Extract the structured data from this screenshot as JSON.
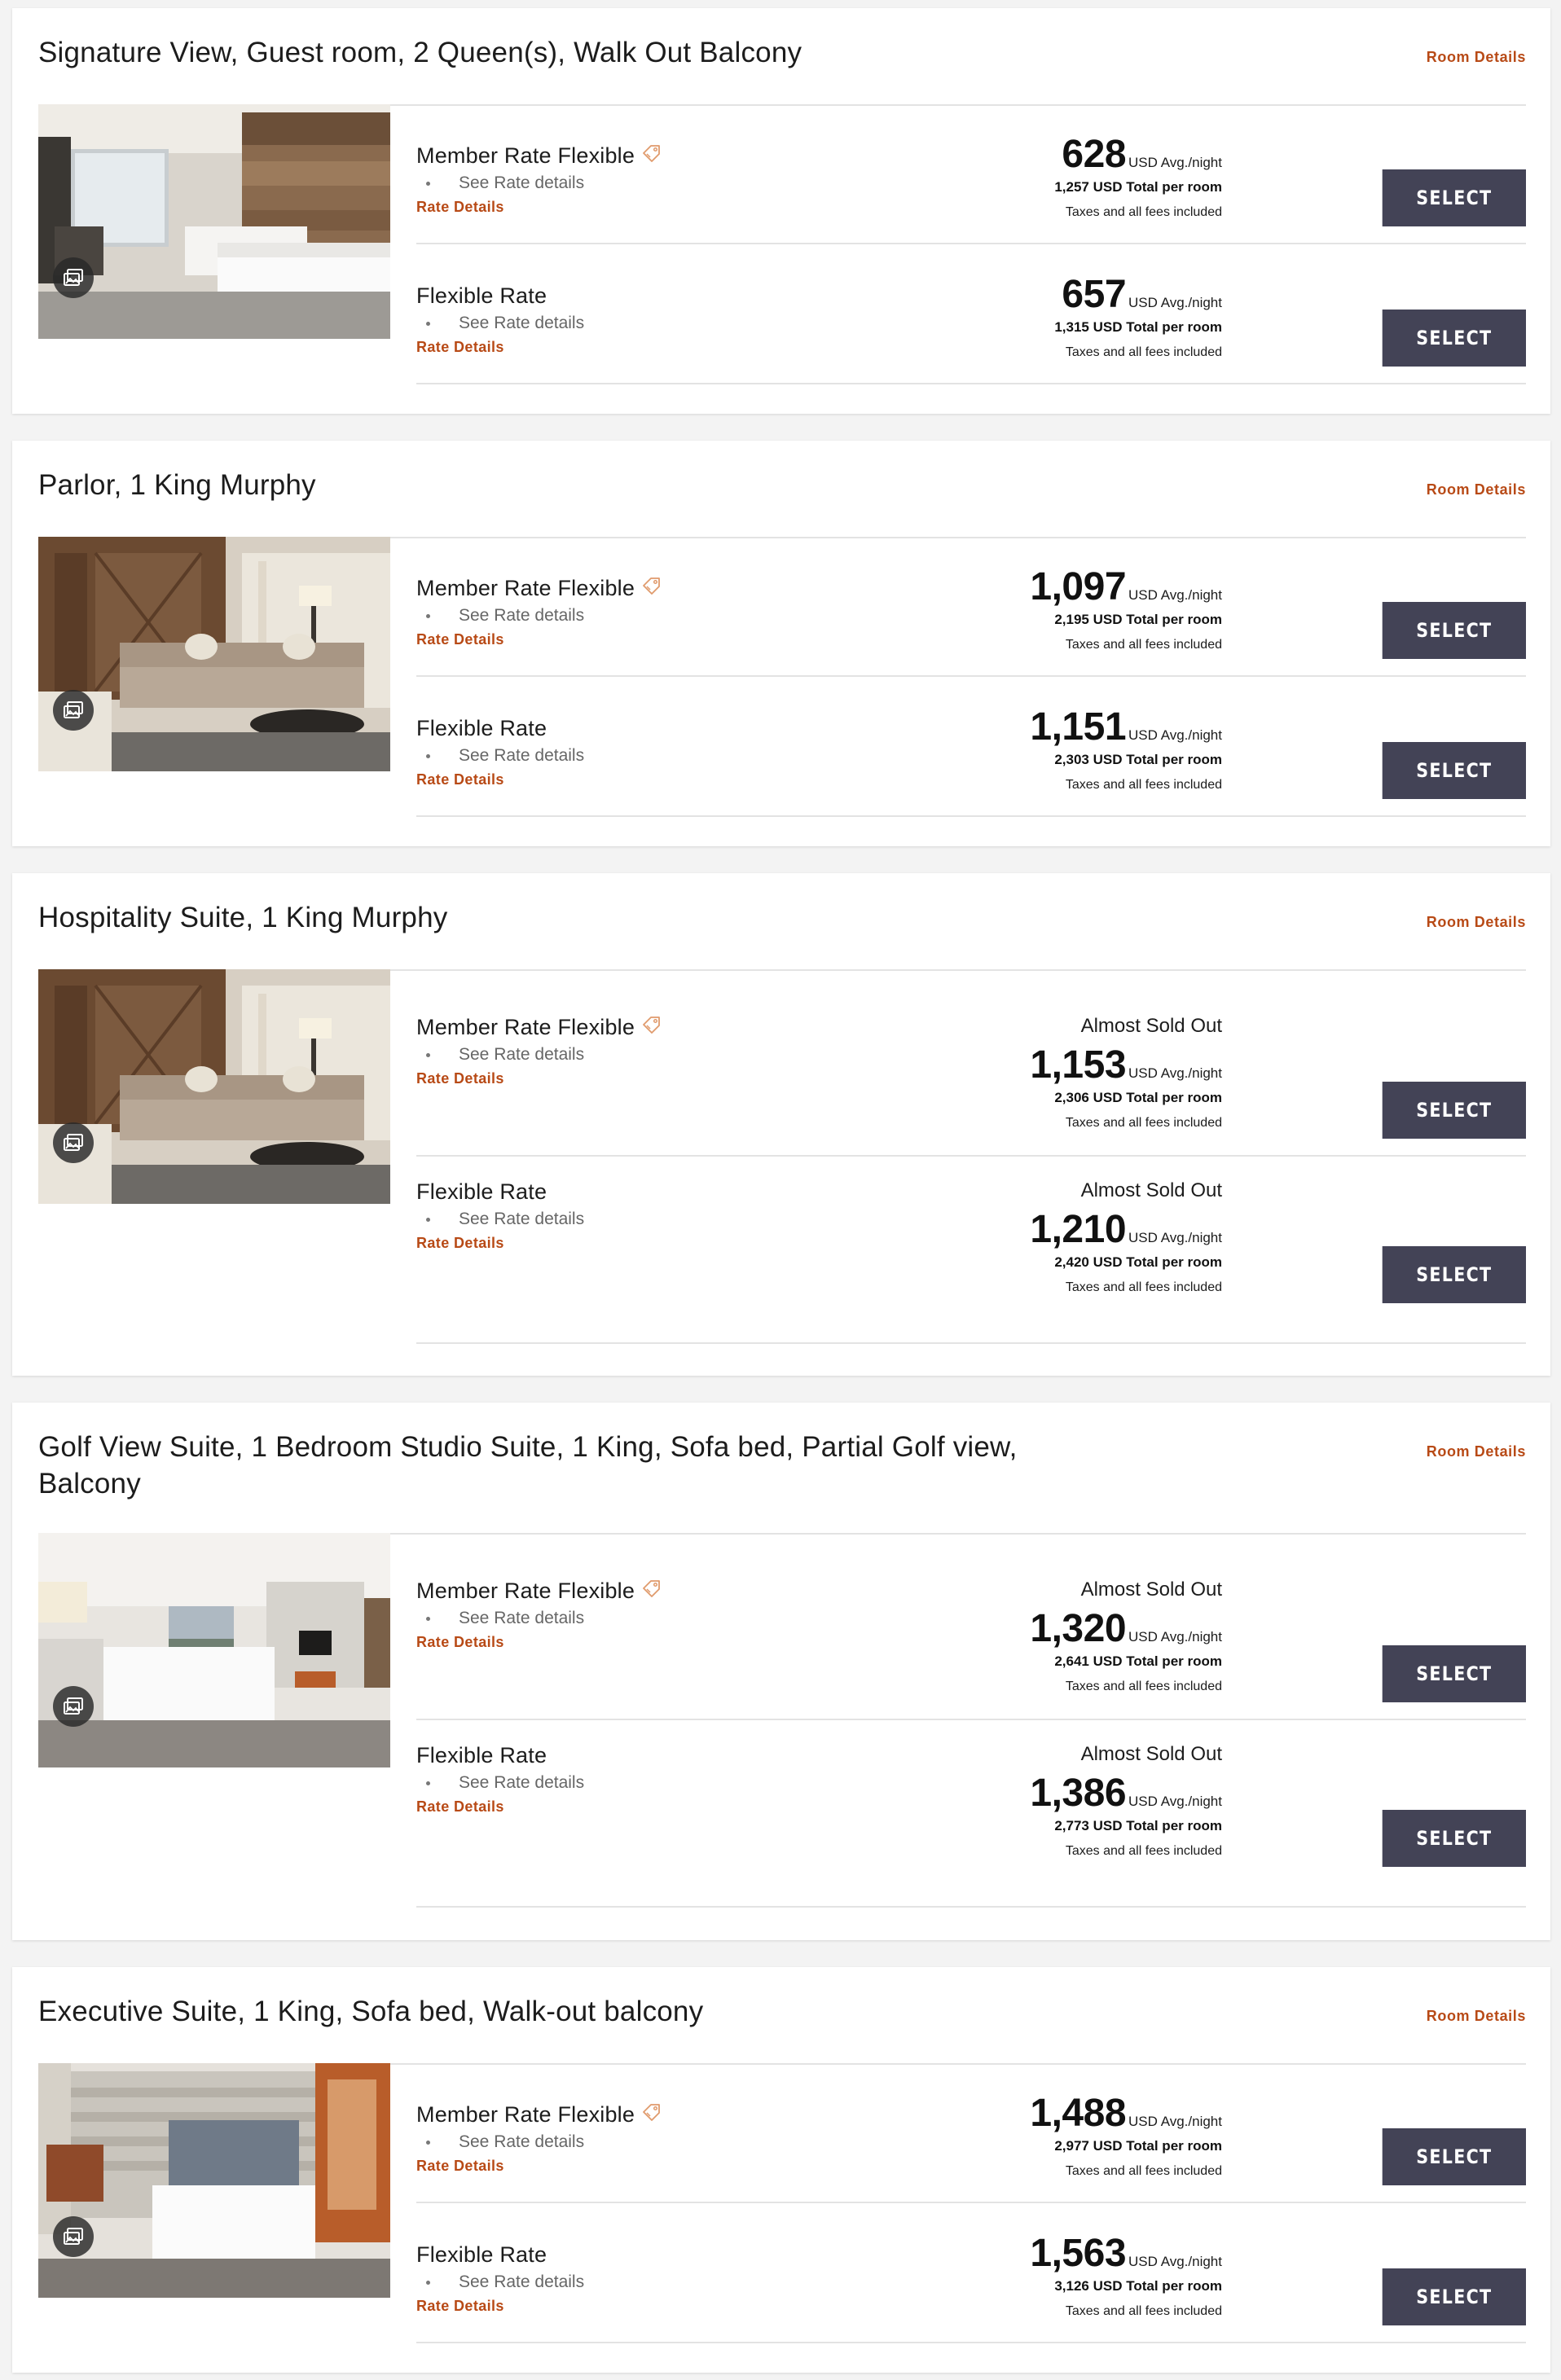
{
  "room_details_label": "Room Details",
  "rate_details_label": "Rate Details",
  "see_rate_details_label": "See Rate details",
  "select_label": "SELECT",
  "unit_label": "USD Avg./night",
  "total_suffix": "USD Total per room",
  "taxes_label": "Taxes and all fees included",
  "icons": {
    "gallery": "image-gallery-icon",
    "tag": "price-tag-icon"
  },
  "colors": {
    "accent": "#b84a16",
    "button": "#434356",
    "background": "#f3f3f3"
  },
  "rooms": [
    {
      "title": "Signature View, Guest room, 2 Queen(s), Walk Out Balcony",
      "rates": [
        {
          "name": "Member Rate Flexible",
          "member": true,
          "sold_out": "",
          "price": "628",
          "total": "1,257"
        },
        {
          "name": "Flexible Rate",
          "member": false,
          "sold_out": "",
          "price": "657",
          "total": "1,315"
        }
      ]
    },
    {
      "title": "Parlor, 1 King Murphy",
      "rates": [
        {
          "name": "Member Rate Flexible",
          "member": true,
          "sold_out": "",
          "price": "1,097",
          "total": "2,195"
        },
        {
          "name": "Flexible Rate",
          "member": false,
          "sold_out": "",
          "price": "1,151",
          "total": "2,303"
        }
      ]
    },
    {
      "title": "Hospitality Suite, 1 King Murphy",
      "rates": [
        {
          "name": "Member Rate Flexible",
          "member": true,
          "sold_out": "Almost Sold Out",
          "price": "1,153",
          "total": "2,306"
        },
        {
          "name": "Flexible Rate",
          "member": false,
          "sold_out": "Almost Sold Out",
          "price": "1,210",
          "total": "2,420"
        }
      ]
    },
    {
      "title": "Golf View Suite, 1 Bedroom Studio Suite, 1 King, Sofa bed, Partial Golf view, Balcony",
      "rates": [
        {
          "name": "Member Rate Flexible",
          "member": true,
          "sold_out": "Almost Sold Out",
          "price": "1,320",
          "total": "2,641"
        },
        {
          "name": "Flexible Rate",
          "member": false,
          "sold_out": "Almost Sold Out",
          "price": "1,386",
          "total": "2,773"
        }
      ]
    },
    {
      "title": "Executive Suite, 1 King, Sofa bed, Walk-out balcony",
      "rates": [
        {
          "name": "Member Rate Flexible",
          "member": true,
          "sold_out": "",
          "price": "1,488",
          "total": "2,977"
        },
        {
          "name": "Flexible Rate",
          "member": false,
          "sold_out": "",
          "price": "1,563",
          "total": "3,126"
        }
      ]
    }
  ]
}
